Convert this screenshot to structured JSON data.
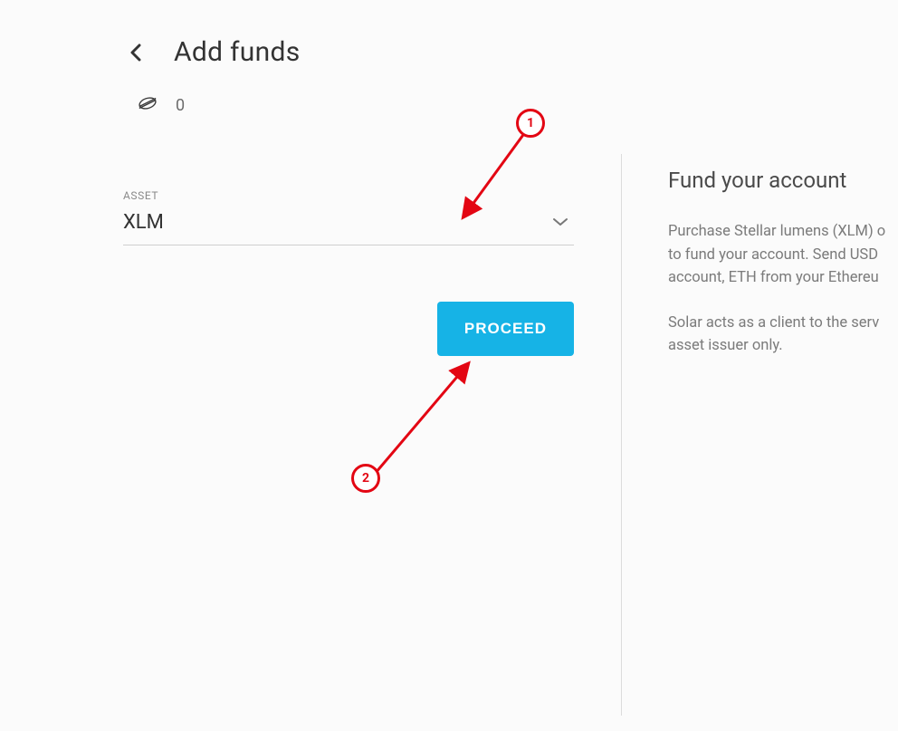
{
  "header": {
    "title": "Add funds"
  },
  "balance": {
    "value": "0"
  },
  "asset": {
    "label": "ASSET",
    "selected": "XLM"
  },
  "actions": {
    "proceed_label": "PROCEED"
  },
  "sidebar": {
    "title": "Fund your account",
    "p1": "Purchase Stellar lumens (XLM) o to fund your account. Send USD account, ETH from your Ethereu",
    "p2": "Solar acts as a client to the serv asset issuer only."
  },
  "annotations": {
    "n1": "1",
    "n2": "2"
  }
}
